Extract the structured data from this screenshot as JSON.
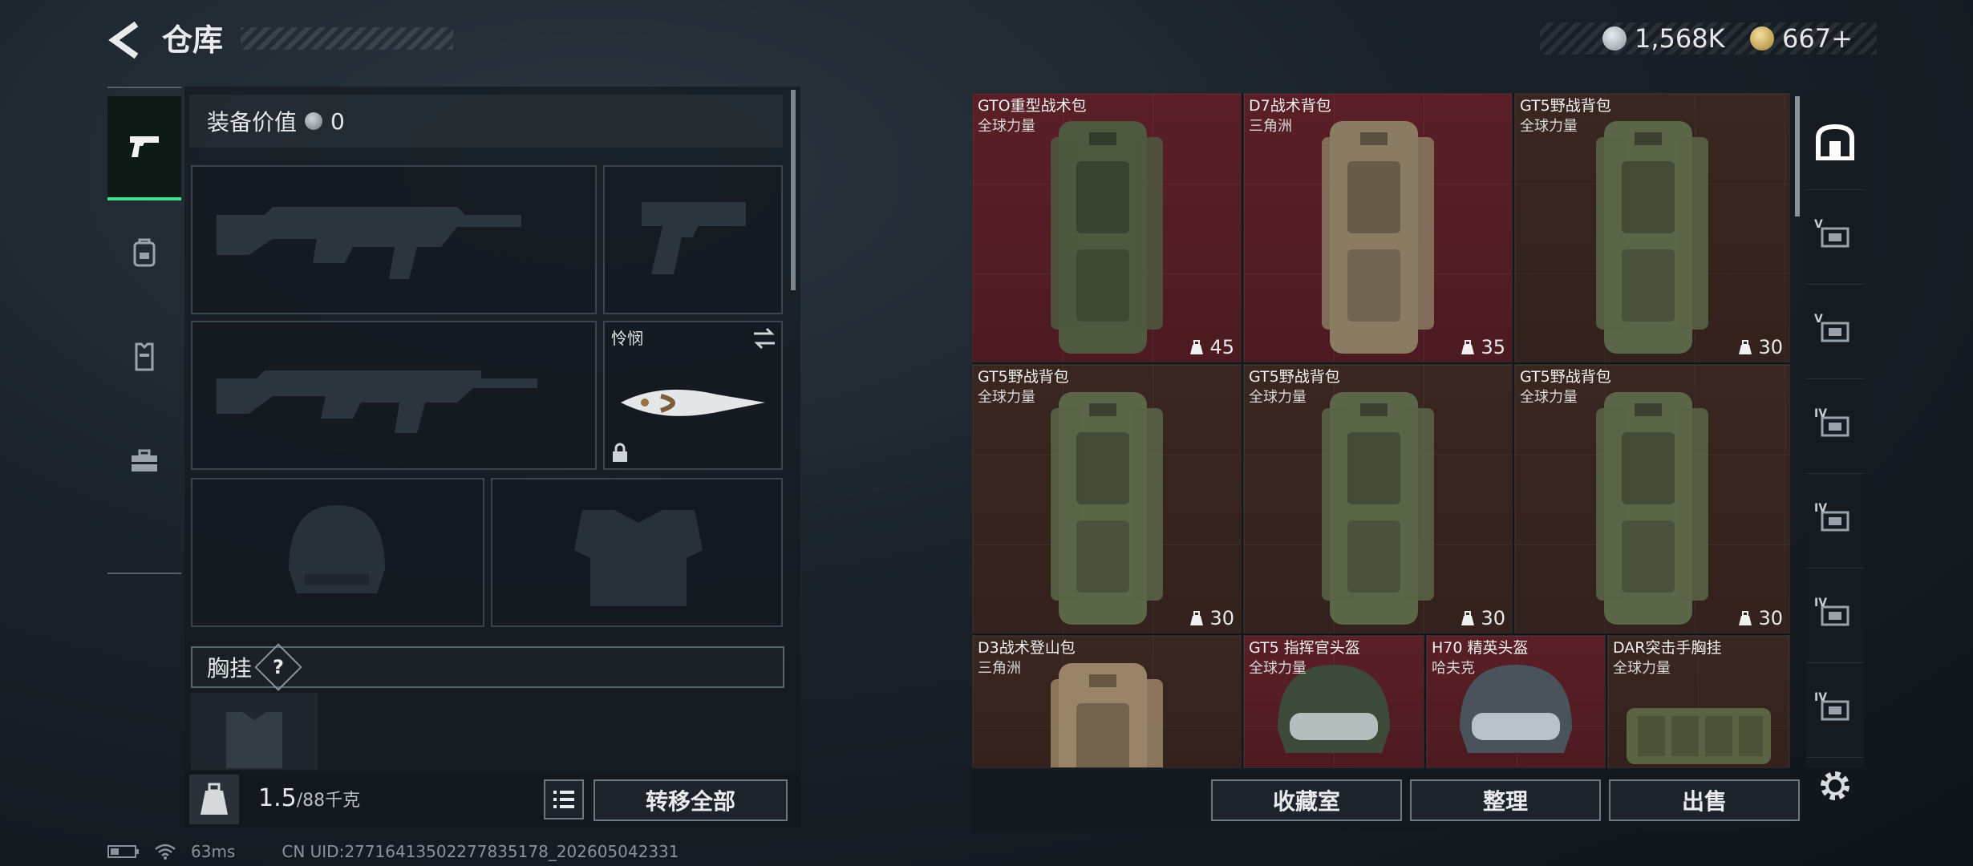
{
  "header": {
    "title": "仓库",
    "currency1": "1,568K",
    "currency2": "667+"
  },
  "loadout": {
    "equip_value_label": "装备价值",
    "equip_value": "0",
    "melee_name": "怜悯",
    "chest_label": "胸挂",
    "chest_help": "?",
    "weight_value": "1.5",
    "weight_max": "/88千克",
    "transfer_all": "转移全部"
  },
  "stash": {
    "items": [
      {
        "name": "GTO重型战术包",
        "brand": "全球力量",
        "capacity": "45",
        "bg": "red"
      },
      {
        "name": "D7战术背包",
        "brand": "三角洲",
        "capacity": "35",
        "bg": "red"
      },
      {
        "name": "GT5野战背包",
        "brand": "全球力量",
        "capacity": "30",
        "bg": "brown"
      },
      {
        "name": "GT5野战背包",
        "brand": "全球力量",
        "capacity": "30",
        "bg": "brown"
      },
      {
        "name": "GT5野战背包",
        "brand": "全球力量",
        "capacity": "30",
        "bg": "brown"
      },
      {
        "name": "GT5野战背包",
        "brand": "全球力量",
        "capacity": "30",
        "bg": "brown"
      },
      {
        "name": "D3战术登山包",
        "brand": "三角洲",
        "capacity": "",
        "bg": "brown"
      },
      {
        "name": "GT5 指挥官头盔",
        "brand": "全球力量",
        "capacity": "",
        "bg": "red"
      },
      {
        "name": "H70 精英头盔",
        "brand": "哈夫克",
        "capacity": "",
        "bg": "red"
      },
      {
        "name": "DAR突击手胸挂",
        "brand": "全球力量",
        "capacity": "",
        "bg": "brown"
      }
    ],
    "buttons": {
      "collection": "收藏室",
      "organize": "整理",
      "sell": "出售"
    }
  },
  "right_tabs": [
    "V",
    "V",
    "IV",
    "IV",
    "IV",
    "IV"
  ],
  "status": {
    "ping": "63ms",
    "uid": "CN UID:27716413502277835178_202605042331"
  },
  "colors": {
    "accent_green": "#3ee08a",
    "rare_red": "#5a1f26",
    "common_brown": "#3a2620"
  }
}
